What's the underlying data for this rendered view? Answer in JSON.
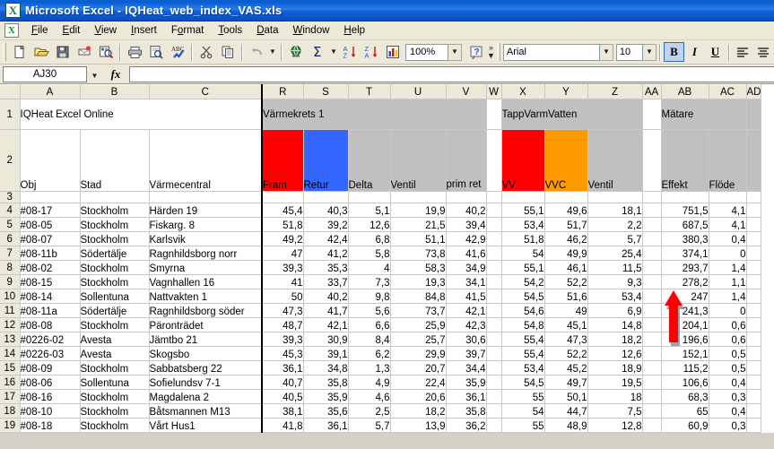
{
  "window": {
    "title": "Microsoft Excel - IQHeat_web_index_VAS.xls",
    "app_icon": "excel-logo-icon"
  },
  "menu": {
    "items": [
      {
        "label": "File"
      },
      {
        "label": "Edit"
      },
      {
        "label": "View"
      },
      {
        "label": "Insert"
      },
      {
        "label": "Format"
      },
      {
        "label": "Tools"
      },
      {
        "label": "Data"
      },
      {
        "label": "Window"
      },
      {
        "label": "Help"
      }
    ]
  },
  "toolbar": {
    "buttons": [
      {
        "name": "new-document-icon"
      },
      {
        "name": "open-folder-icon"
      },
      {
        "name": "save-icon"
      },
      {
        "name": "email-icon"
      },
      {
        "name": "search-icon"
      },
      {
        "name": "print-icon"
      },
      {
        "name": "print-preview-icon"
      },
      {
        "name": "spelling-check-icon"
      },
      {
        "name": "cut-scissors-icon"
      },
      {
        "name": "copy-icon"
      },
      {
        "name": "undo-icon"
      },
      {
        "name": "hyperlink-globe-icon"
      },
      {
        "name": "autosum-icon"
      },
      {
        "name": "sort-ascending-icon"
      },
      {
        "name": "sort-descending-icon"
      },
      {
        "name": "chart-wizard-icon"
      }
    ],
    "zoom_value": "100%",
    "help_icon": "help-question-icon",
    "overflow_icon": "toolbar-overflow-chevrons",
    "font_name": "Arial",
    "font_size": "10",
    "bold_label": "B",
    "italic_label": "I",
    "underline_label": "U",
    "align_left_icon": "align-left-icon",
    "align_center_icon": "align-center-icon"
  },
  "formula_bar": {
    "name_box": "AJ30",
    "fx_label": "fx",
    "formula_value": ""
  },
  "sheet": {
    "columns": [
      "A",
      "B",
      "C",
      "R",
      "S",
      "T",
      "U",
      "V",
      "W",
      "X",
      "Y",
      "Z",
      "AA",
      "AB",
      "AC",
      "AD"
    ],
    "row_numbers": [
      "1",
      "2",
      "3",
      "4",
      "5",
      "6",
      "7",
      "8",
      "9",
      "10",
      "11",
      "12",
      "13",
      "14",
      "15",
      "16",
      "17",
      "18",
      "19"
    ],
    "banner": {
      "page_title": "IQHeat Excel Online",
      "group_heating": "Värmekrets 1",
      "group_hotwater": "TappVarmVatten",
      "group_meters": "Mätare"
    },
    "headers": {
      "obj": "Obj",
      "stad": "Stad",
      "varmecentral": "Värmecentral",
      "fram": "Fram",
      "retur": "Retur",
      "delta": "Delta",
      "ventil1": "Ventil",
      "primret": "prim ret",
      "vv": "VV",
      "vvc": "VVC",
      "ventil2": "Ventil",
      "effekt": "Effekt",
      "flode": "Flöde"
    },
    "colors": {
      "fram": "#ff0000",
      "retur": "#3366ff",
      "vv": "#ff0000",
      "vvc": "#ff9900",
      "band": "#c0c0c0",
      "arrow": "#ff0000"
    },
    "rows": [
      {
        "obj": "#08-17",
        "stad": "Stockholm",
        "vc": "Härden 19",
        "fram": "45,4",
        "retur": "40,3",
        "delta": "5,1",
        "ventil1": "19,9",
        "primret": "40,2",
        "vv": "55,1",
        "vvc": "49,6",
        "ventil2": "18,1",
        "effekt": "751,5",
        "flode": "4,1"
      },
      {
        "obj": "#08-05",
        "stad": "Stockholm",
        "vc": "Fiskarg. 8",
        "fram": "51,8",
        "retur": "39,2",
        "delta": "12,6",
        "ventil1": "21,5",
        "primret": "39,4",
        "vv": "53,4",
        "vvc": "51,7",
        "ventil2": "2,2",
        "effekt": "687,5",
        "flode": "4,1"
      },
      {
        "obj": "#08-07",
        "stad": "Stockholm",
        "vc": "Karlsvik",
        "fram": "49,2",
        "retur": "42,4",
        "delta": "6,8",
        "ventil1": "51,1",
        "primret": "42,9",
        "vv": "51,8",
        "vvc": "46,2",
        "ventil2": "5,7",
        "effekt": "380,3",
        "flode": "0,4"
      },
      {
        "obj": "#08-11b",
        "stad": "Södertälje",
        "vc": "Ragnhildsborg norr",
        "fram": "47",
        "retur": "41,2",
        "delta": "5,8",
        "ventil1": "73,8",
        "primret": "41,6",
        "vv": "54",
        "vvc": "49,9",
        "ventil2": "25,4",
        "effekt": "374,1",
        "flode": "0"
      },
      {
        "obj": "#08-02",
        "stad": "Stockholm",
        "vc": "Smyrna",
        "fram": "39,3",
        "retur": "35,3",
        "delta": "4",
        "ventil1": "58,3",
        "primret": "34,9",
        "vv": "55,1",
        "vvc": "46,1",
        "ventil2": "11,5",
        "effekt": "293,7",
        "flode": "1,4"
      },
      {
        "obj": "#08-15",
        "stad": "Stockholm",
        "vc": "Vagnhallen 16",
        "fram": "41",
        "retur": "33,7",
        "delta": "7,3",
        "ventil1": "19,3",
        "primret": "34,1",
        "vv": "54,2",
        "vvc": "52,2",
        "ventil2": "9,3",
        "effekt": "278,2",
        "flode": "1,1"
      },
      {
        "obj": "#08-14",
        "stad": "Sollentuna",
        "vc": "Nattvakten 1",
        "fram": "50",
        "retur": "40,2",
        "delta": "9,8",
        "ventil1": "84,8",
        "primret": "41,5",
        "vv": "54,5",
        "vvc": "51,6",
        "ventil2": "53,4",
        "effekt": "247",
        "flode": "1,4"
      },
      {
        "obj": "#08-11a",
        "stad": "Södertälje",
        "vc": "Ragnhildsborg söder",
        "fram": "47,3",
        "retur": "41,7",
        "delta": "5,6",
        "ventil1": "73,7",
        "primret": "42,1",
        "vv": "54,6",
        "vvc": "49",
        "ventil2": "6,9",
        "effekt": "241,3",
        "flode": "0"
      },
      {
        "obj": "#08-08",
        "stad": "Stockholm",
        "vc": "Päronträdet",
        "fram": "48,7",
        "retur": "42,1",
        "delta": "6,6",
        "ventil1": "25,9",
        "primret": "42,3",
        "vv": "54,8",
        "vvc": "45,1",
        "ventil2": "14,8",
        "effekt": "204,1",
        "flode": "0,6"
      },
      {
        "obj": "#0226-02",
        "stad": "Avesta",
        "vc": "Jämtbo 21",
        "fram": "39,3",
        "retur": "30,9",
        "delta": "8,4",
        "ventil1": "25,7",
        "primret": "30,6",
        "vv": "55,4",
        "vvc": "47,3",
        "ventil2": "18,2",
        "effekt": "196,6",
        "flode": "0,6"
      },
      {
        "obj": "#0226-03",
        "stad": "Avesta",
        "vc": "Skogsbo",
        "fram": "45,3",
        "retur": "39,1",
        "delta": "6,2",
        "ventil1": "29,9",
        "primret": "39,7",
        "vv": "55,4",
        "vvc": "52,2",
        "ventil2": "12,6",
        "effekt": "152,1",
        "flode": "0,5"
      },
      {
        "obj": "#08-09",
        "stad": "Stockholm",
        "vc": "Sabbatsberg 22",
        "fram": "36,1",
        "retur": "34,8",
        "delta": "1,3",
        "ventil1": "20,7",
        "primret": "34,4",
        "vv": "53,4",
        "vvc": "45,2",
        "ventil2": "18,9",
        "effekt": "115,2",
        "flode": "0,5"
      },
      {
        "obj": "#08-06",
        "stad": "Sollentuna",
        "vc": "Sofielundsv 7-1",
        "fram": "40,7",
        "retur": "35,8",
        "delta": "4,9",
        "ventil1": "22,4",
        "primret": "35,9",
        "vv": "54,5",
        "vvc": "49,7",
        "ventil2": "19,5",
        "effekt": "106,6",
        "flode": "0,4"
      },
      {
        "obj": "#08-16",
        "stad": "Stockholm",
        "vc": "Magdalena 2",
        "fram": "40,5",
        "retur": "35,9",
        "delta": "4,6",
        "ventil1": "20,6",
        "primret": "36,1",
        "vv": "55",
        "vvc": "50,1",
        "ventil2": "18",
        "effekt": "68,3",
        "flode": "0,3"
      },
      {
        "obj": "#08-10",
        "stad": "Stockholm",
        "vc": "Båtsmannen M13",
        "fram": "38,1",
        "retur": "35,6",
        "delta": "2,5",
        "ventil1": "18,2",
        "primret": "35,8",
        "vv": "54",
        "vvc": "44,7",
        "ventil2": "7,5",
        "effekt": "65",
        "flode": "0,4"
      },
      {
        "obj": "#08-18",
        "stad": "Stockholm",
        "vc": "Vårt Hus1",
        "fram": "41,8",
        "retur": "36,1",
        "delta": "5,7",
        "ventil1": "13,9",
        "primret": "36,2",
        "vv": "55",
        "vvc": "48,9",
        "ventil2": "12,8",
        "effekt": "60,9",
        "flode": "0,3"
      }
    ]
  }
}
